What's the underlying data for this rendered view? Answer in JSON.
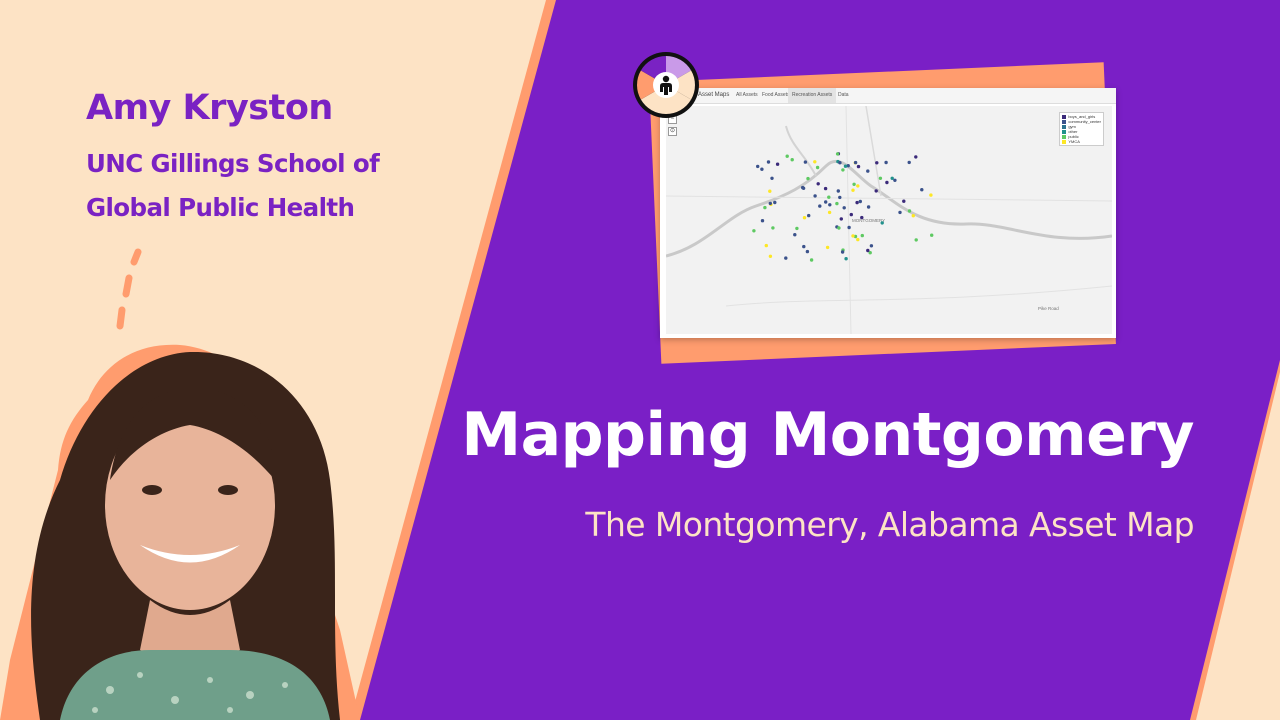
{
  "speaker": {
    "name": "Amy Kryston",
    "affiliation_line1": "UNC Gillings School of",
    "affiliation_line2": "Global Public Health"
  },
  "talk": {
    "title": "Mapping Montgomery",
    "subtitle": "The Montgomery, Alabama Asset Map"
  },
  "map_screenshot": {
    "brand": "Asset Maps",
    "tabs": [
      "All Assets",
      "Food Assets",
      "Recreation Assets",
      "Data"
    ],
    "active_tab": "Recreation Assets",
    "zoom_in": "+",
    "zoom_out": "−",
    "locate": "⊙",
    "legend": [
      {
        "label": "boys_and_girls",
        "color": "#3b2a7a"
      },
      {
        "label": "community_center",
        "color": "#3b528b"
      },
      {
        "label": "gym",
        "color": "#2c728e"
      },
      {
        "label": "other",
        "color": "#21918c"
      },
      {
        "label": "public",
        "color": "#5ec962"
      },
      {
        "label": "YMCA",
        "color": "#fde725"
      }
    ],
    "places": [
      "MONTGOMERY",
      "Pike Road"
    ]
  },
  "colors": {
    "background": "#fde3c5",
    "purple": "#7a22c3",
    "orange_accent": "#ff9c6e",
    "title_white": "#ffffff",
    "subtitle_cream": "#fde3c5"
  },
  "icons": {
    "logo": "person-wheel-icon",
    "dashes": "decorative-dash-icon"
  }
}
